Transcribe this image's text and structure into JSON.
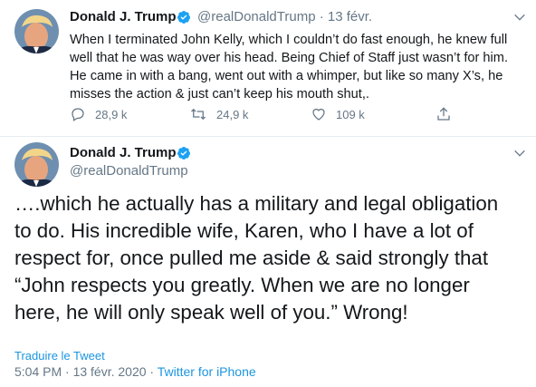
{
  "tweet1": {
    "name": "Donald J. Trump",
    "handle": "@realDonaldTrump",
    "separator": "·",
    "date": "13 févr.",
    "text": "When I terminated John Kelly, which I couldn’t do fast enough, he knew full\nwell that he was way over his head. Being Chief of Staff just wasn’t for him.\nHe came in with a bang, went out with a whimper, but like so many X’s, he\nmisses the action & just can’t keep his mouth shut,.",
    "replies": "28,9 k",
    "retweets": "24,9 k",
    "likes": "109 k"
  },
  "tweet2": {
    "name": "Donald J. Trump",
    "handle": "@realDonaldTrump",
    "text": "….which he actually has a military and legal obligation\nto do. His incredible wife, Karen, who I have a lot of\nrespect for, once pulled me aside & said strongly that\n“John respects you greatly. When we are no longer\nhere, he will only speak well of you.” Wrong!",
    "translate": "Traduire le Tweet",
    "time": "5:04 PM · 13 févr. 2020 · ",
    "source": "Twitter for iPhone"
  },
  "colors": {
    "verified": "#1da1f2",
    "link": "#1b95e0",
    "muted": "#657786"
  },
  "icons": [
    "verified-badge-icon",
    "chevron-down-icon",
    "reply-icon",
    "retweet-icon",
    "like-icon",
    "share-icon"
  ]
}
